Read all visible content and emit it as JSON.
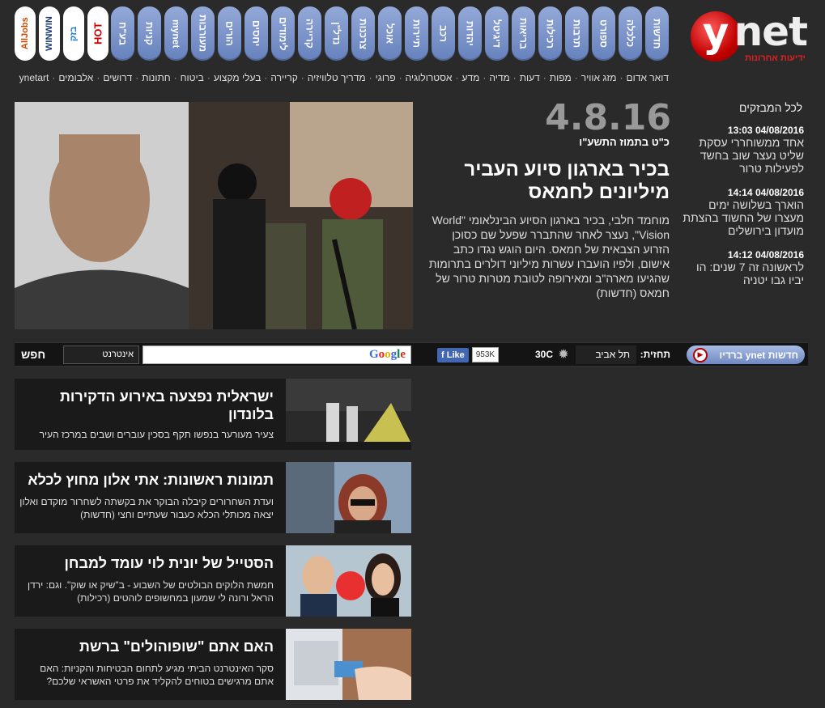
{
  "logo": {
    "mark": "y",
    "name": "net",
    "tagline": "ידיעות אחרונות"
  },
  "nav_tabs": [
    "חדשות",
    "כלכלה",
    "ספורט",
    "תרבות",
    "רכילות",
    "בריאות",
    "דיגיטל",
    "יהדות",
    "רכב",
    "תיירות",
    "אוכל",
    "צרכנות",
    "נדל\"ן",
    "קריירה",
    "לימודים",
    "יחסים",
    "הורים",
    "מעורבות",
    "mynet",
    "קניות",
    "בע\"ח"
  ],
  "brand_tabs": [
    "HOT",
    "בזק",
    "WINWIN",
    "AllJobs"
  ],
  "subnav": [
    "דואר אדום",
    "מזג אוויר",
    "מפות",
    "דעות",
    "מדיה",
    "מדע",
    "אסטרולוגיה",
    "פרוגי",
    "מדריך טלוויזיה",
    "קריירה",
    "בעלי מקצוע",
    "ביטוח",
    "חתונות",
    "דרושים",
    "אלבומים",
    "ynetart"
  ],
  "live": {
    "header": "לכל המבזקים",
    "entries": [
      {
        "time": "04/08/2016 13:03",
        "text": "אחד ממשוחררי עסקת שליט נעצר שוב בחשד לפעילות טרור"
      },
      {
        "time": "04/08/2016 14:14",
        "text": "הוארך בשלושה ימים מעצרו של החשוד בהצתת מועדון בירושלים"
      },
      {
        "time": "04/08/2016 14:12",
        "text": "לראשונה זה 7 שנים: הו יביו גבו יטניה"
      }
    ]
  },
  "main_story": {
    "date": "4.8.16",
    "hebrew_date": "כ\"ט בתמוז התשע\"ו",
    "headline": "בכיר בארגון סיוע העביר מיליונים לחמאס",
    "lede": "מוחמד חלבי, בכיר בארגון הסיוע הבינלאומי \"World Vision\", נעצר לאחר שהתברר שפעל שם כסוכן הזרוע הצבאית של חמאס. היום הוגש נגדו כתב אישום, ולפיו הועברו עשרות מיליוני דולרים בתרומות שהגיעו מארה\"ב ומאירופה לטובת מטרות טרור של חמאס (חדשות)"
  },
  "toolbar": {
    "radio_label": "חדשות ynet ברדיו",
    "forecast_label": "תחזית:",
    "city": "תל אביב",
    "temperature": "30C",
    "fb_like": "Like",
    "fb_count": "953K",
    "search_scope": "אינטרנט",
    "search_button": "חפש",
    "search_placeholder": ""
  },
  "articles": [
    {
      "title": "ישראלית נפצעה באירוע הדקירות בלונדון",
      "desc": "צעיר מעורער בנפשו תקף בסכין עוברים ושבים במרכז העיר"
    },
    {
      "title": "תמונות ראשונות: אתי אלון מחוץ לכלא",
      "desc": "ועדת השחרורים קיבלה הבוקר את בקשתה לשחרור מוקדם ואלון יצאה מכותלי הכלא כעבור שעתיים וחצי (חדשות)"
    },
    {
      "title": "הסטייל של יונית לוי עומד למבחן",
      "desc": "חמשת הלוקים הבולטים של השבוע - ב\"שיק או שוק\". וגם: ירדן הראל ורונה לי שמעון במחשופים לוהטים (רכילות)"
    },
    {
      "title": "האם אתם \"שופוהולים\" ברשת",
      "desc": "סקר האינטרנט הביתי מגיע לתחום הבטיחות והקניות: האם אתם מרגישים בטוחים להקליד את פרטי האשראי שלכם?"
    }
  ],
  "icons": {
    "play": "play-icon",
    "sun": "sun-icon",
    "facebook": "facebook-like-icon",
    "google": "google-logo"
  },
  "colors": {
    "background": "#2a2a2a",
    "tab_blue": "#7a93cb",
    "logo_red": "#c00000"
  }
}
